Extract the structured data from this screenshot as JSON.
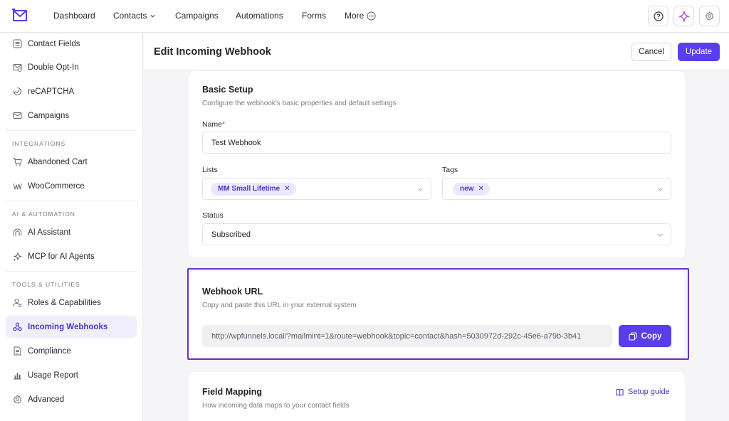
{
  "nav": {
    "items": [
      {
        "label": "Dashboard"
      },
      {
        "label": "Contacts"
      },
      {
        "label": "Campaigns"
      },
      {
        "label": "Automations"
      },
      {
        "label": "Forms"
      },
      {
        "label": "More"
      }
    ]
  },
  "sidebar": {
    "top_items": [
      {
        "label": "Contact Fields",
        "icon": "list-icon"
      },
      {
        "label": "Double Opt-In",
        "icon": "mail-check-icon"
      },
      {
        "label": "reCAPTCHA",
        "icon": "recaptcha-icon"
      },
      {
        "label": "Campaigns",
        "icon": "envelope-icon"
      }
    ],
    "sections": [
      {
        "title": "INTEGRATIONS",
        "items": [
          {
            "label": "Abandoned Cart",
            "icon": "cart-icon"
          },
          {
            "label": "WooCommerce",
            "icon": "woo-icon"
          }
        ]
      },
      {
        "title": "AI & AUTOMATION",
        "items": [
          {
            "label": "AI Assistant",
            "icon": "ai-icon"
          },
          {
            "label": "MCP for AI Agents",
            "icon": "sparkle-icon"
          }
        ]
      },
      {
        "title": "TOOLS & UTILITIES",
        "items": [
          {
            "label": "Roles & Capabilities",
            "icon": "user-icon"
          },
          {
            "label": "Incoming Webhooks",
            "icon": "webhook-icon",
            "active": true
          },
          {
            "label": "Compliance",
            "icon": "document-icon"
          },
          {
            "label": "Usage Report",
            "icon": "bar-chart-icon"
          },
          {
            "label": "Advanced",
            "icon": "gear-icon"
          }
        ]
      }
    ]
  },
  "header": {
    "title": "Edit Incoming Webhook",
    "cancel_label": "Cancel",
    "update_label": "Update"
  },
  "basic_setup": {
    "title": "Basic Setup",
    "subtitle": "Configure the webhook's basic properties and default settings",
    "name_label": "Name",
    "name_required": "*",
    "name_value": "Test Webhook",
    "lists_label": "Lists",
    "lists_values": [
      "MM Small Lifetime"
    ],
    "tags_label": "Tags",
    "tags_values": [
      "new"
    ],
    "status_label": "Status",
    "status_value": "Subscribed"
  },
  "webhook_url": {
    "title": "Webhook URL",
    "subtitle": "Copy and paste this URL in your external system",
    "url": "http://wpfunnels.local/?mailmint=1&route=webhook&topic=contact&hash=5030972d-292c-45e6-a79b-3b41",
    "copy_label": "Copy"
  },
  "field_mapping": {
    "title": "Field Mapping",
    "subtitle": "How incoming data maps to your contact fields",
    "guide_label": "Setup guide"
  },
  "colors": {
    "accent": "#5b3df0",
    "highlight_border": "#6b2fc9",
    "active_bg": "#f0edfc"
  }
}
